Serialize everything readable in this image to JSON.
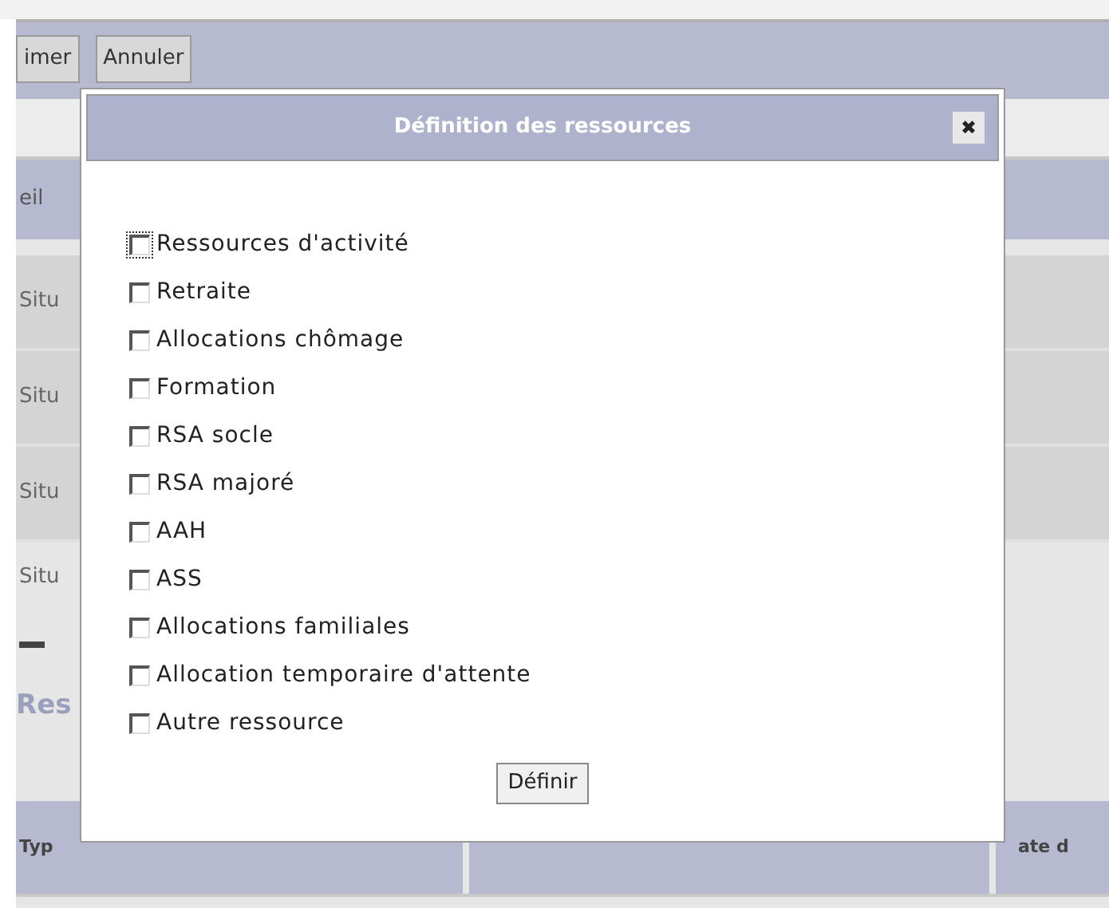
{
  "toolbar": {
    "buttons": [
      "imer",
      "Annuler"
    ]
  },
  "tab_header": {
    "label": "eil"
  },
  "rows": [
    "Situ",
    "Situ",
    "Situ",
    "Situ"
  ],
  "section_title": "Res",
  "table": {
    "columns": [
      "Typ",
      "",
      "ate d"
    ]
  },
  "dialog": {
    "title": "Définition des ressources",
    "close": "✖",
    "options": [
      {
        "label": "Ressources d'activité",
        "checked": false,
        "focused": true
      },
      {
        "label": "Retraite",
        "checked": false,
        "focused": false
      },
      {
        "label": "Allocations chômage",
        "checked": false,
        "focused": false
      },
      {
        "label": "Formation",
        "checked": false,
        "focused": false
      },
      {
        "label": "RSA socle",
        "checked": false,
        "focused": false
      },
      {
        "label": "RSA majoré",
        "checked": false,
        "focused": false
      },
      {
        "label": "AAH",
        "checked": false,
        "focused": false
      },
      {
        "label": "ASS",
        "checked": false,
        "focused": false
      },
      {
        "label": "Allocations familiales",
        "checked": false,
        "focused": false
      },
      {
        "label": "Allocation temporaire d'attente",
        "checked": false,
        "focused": false
      },
      {
        "label": "Autre ressource",
        "checked": false,
        "focused": false
      }
    ],
    "button": "Définir"
  }
}
